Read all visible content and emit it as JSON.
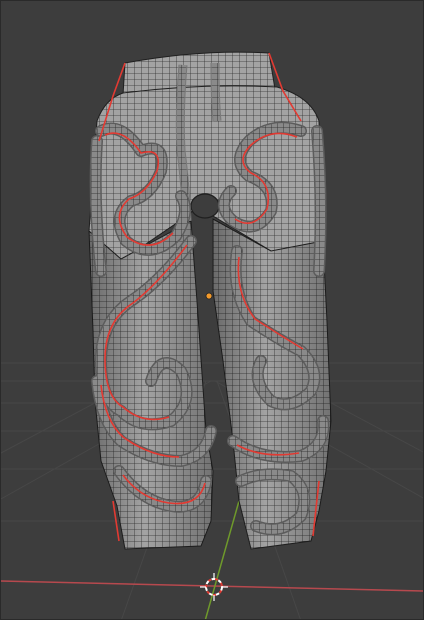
{
  "viewport": {
    "background": "#3d3d3d",
    "grid_color": "#474747",
    "x_axis_color": "#b7494e",
    "y_axis_color": "#6f9a2b",
    "mesh_fill": "#9a9a9a",
    "wire_color": "#2c2c2c",
    "seam_color": "#e23a32",
    "origin_color": "#f39a2b",
    "cursor_color": "#ffffff"
  },
  "scene": {
    "object": "pants-mesh",
    "mode": "edit-wireframe",
    "visible_items": [
      "3d-cursor",
      "object-origin",
      "x-axis-line",
      "y-axis-line"
    ]
  }
}
